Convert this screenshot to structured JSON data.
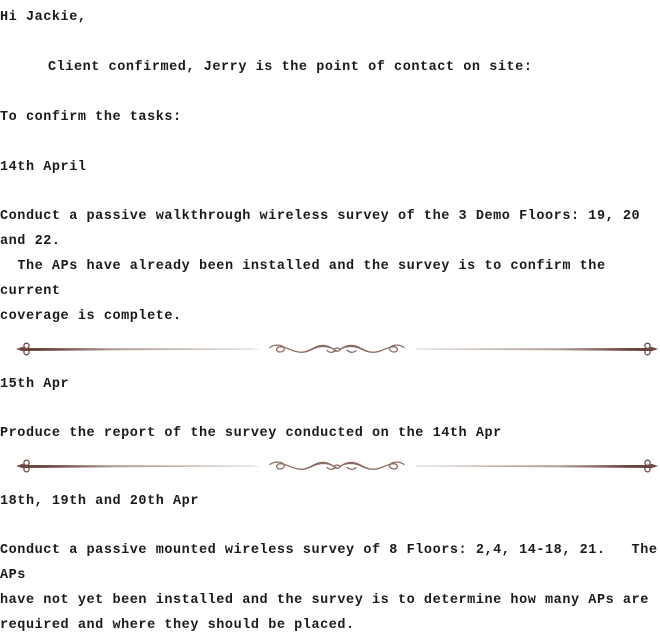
{
  "document": {
    "background_color": "#ffffff",
    "text_color": "#1a1a1a",
    "ornament_color_dark": "#5c3a33",
    "ornament_color_mid": "#8a6a60",
    "ornament_color_light": "#c9b8b0",
    "blocks": [
      {
        "id": "greeting",
        "type": "paragraph",
        "indent": false,
        "text": "Hi Jackie,"
      },
      {
        "id": "client-confirm",
        "type": "paragraph",
        "indent": true,
        "text": "Client confirmed, Jerry is the point of contact on site:"
      },
      {
        "id": "confirm-tasks",
        "type": "paragraph",
        "indent": false,
        "text": "To confirm the tasks:"
      },
      {
        "id": "date-14-april",
        "type": "paragraph",
        "indent": false,
        "text": "14th April"
      },
      {
        "id": "task-14-april",
        "type": "paragraph",
        "indent": false,
        "text": "Conduct a passive walkthrough wireless survey of the 3 Demo Floors: 19, 20 and 22.\n  The APs have already been installed and the survey is to confirm the current\ncoverage is complete."
      },
      {
        "id": "divider-1",
        "type": "divider"
      },
      {
        "id": "date-15-apr",
        "type": "paragraph",
        "indent": false,
        "text": "15th Apr"
      },
      {
        "id": "task-15-apr",
        "type": "paragraph",
        "indent": false,
        "text": "Produce the report of the survey conducted on the 14th Apr"
      },
      {
        "id": "divider-2",
        "type": "divider"
      },
      {
        "id": "date-18-19-20",
        "type": "paragraph",
        "indent": false,
        "text": "18th, 19th and 20th Apr"
      },
      {
        "id": "task-18-19-20",
        "type": "paragraph",
        "indent": false,
        "text": "Conduct a passive mounted wireless survey of 8 Floors: 2,4, 14-18, 21.   The APs\nhave not yet been installed and the survey is to determine how many APs are\nrequired and where they should be placed."
      }
    ]
  }
}
